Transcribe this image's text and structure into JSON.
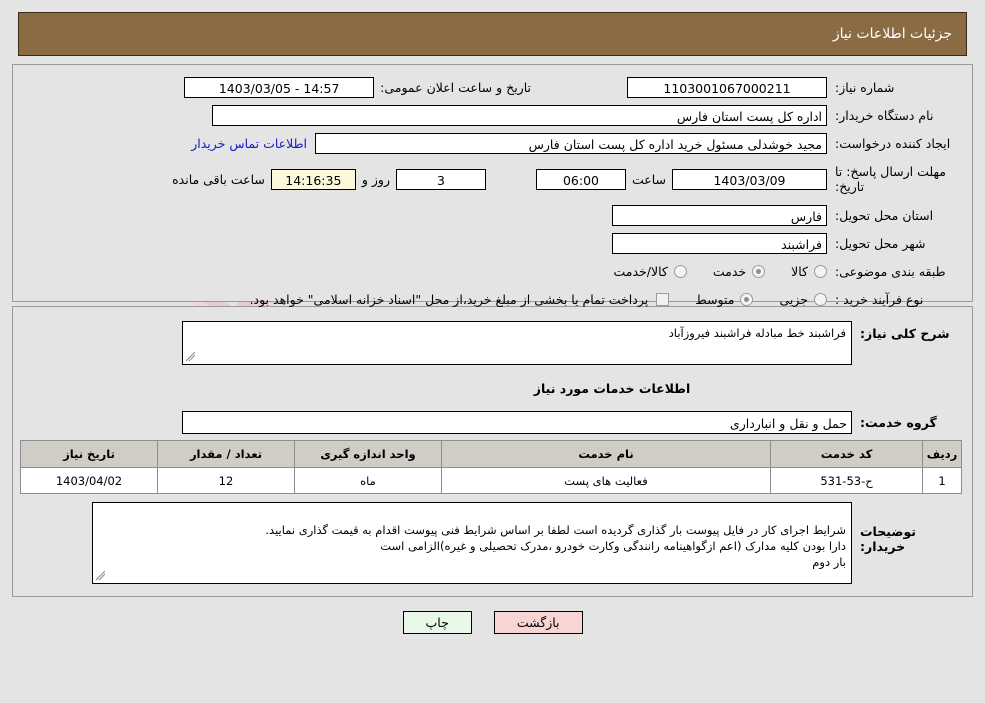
{
  "header": {
    "title": "جزئیات اطلاعات نیاز",
    "bar_color": "#8a6b43"
  },
  "watermark": {
    "text": "AnaTender.net"
  },
  "top_panel": {
    "need_number_label": "شماره نیاز:",
    "need_number_value": "1103001067000211",
    "public_announce_label": "تاریخ و ساعت اعلان عمومی:",
    "public_announce_value": "14:57 - 1403/03/05",
    "buyer_org_label": "نام دستگاه خریدار:",
    "buyer_org_value": "اداره کل پست استان فارس",
    "creator_label": "ایجاد کننده درخواست:",
    "creator_value": "مجید خوشدلی مسئول خرید اداره کل پست استان فارس",
    "contact_link": "اطلاعات تماس خریدار",
    "deadline_label": "مهلت ارسال پاسخ: تا تاریخ:",
    "deadline_date": "1403/03/09",
    "hour_label": "ساعت",
    "deadline_time": "06:00",
    "days_remaining": "3",
    "days_and_label": "روز و",
    "time_remaining": "14:16:35",
    "remaining_suffix_label": "ساعت باقی مانده",
    "province_label": "استان محل تحویل:",
    "province_value": "فارس",
    "city_label": "شهر محل تحویل:",
    "city_value": "فراشبند",
    "category_label": "طبقه بندی موضوعی:",
    "category_options": [
      {
        "label": "کالا",
        "selected": false
      },
      {
        "label": "خدمت",
        "selected": true
      },
      {
        "label": "کالا/خدمت",
        "selected": false
      }
    ],
    "process_label": "نوع فرآیند خرید :",
    "process_options": [
      {
        "label": "جزیی",
        "selected": false
      },
      {
        "label": "متوسط",
        "selected": true
      }
    ],
    "treasury_checkbox_checked": false,
    "treasury_note": "پرداخت تمام یا بخشی از مبلغ خرید،از محل \"اسناد خزانه اسلامی\" خواهد بود."
  },
  "mid_panel": {
    "general_desc_label": "شرح کلی نیاز:",
    "general_desc_value": "فراشبند خط مبادله فراشبند فیروزآباد",
    "services_section_title": "اطلاعات خدمات مورد نیاز",
    "service_group_label": "گروه خدمت:",
    "service_group_value": "حمل و نقل و انبارداری",
    "table": {
      "columns": [
        "ردیف",
        "کد خدمت",
        "نام خدمت",
        "واحد اندازه گیری",
        "تعداد / مقدار",
        "تاریخ نیاز"
      ],
      "rows": [
        {
          "row_no": "1",
          "service_code": "ح-53-531",
          "service_name": "فعالیت های پست",
          "unit": "ماه",
          "quantity": "12",
          "need_date": "1403/04/02"
        }
      ]
    },
    "buyer_notes_label": "توضیحات خریدار:",
    "buyer_notes_value": "شرایط اجرای کار در فایل پیوست بار گذاری گردیده است لطفا بر اساس شرایط فنی پیوست اقدام به قیمت گذاری نمایید.\nدارا بودن کلیه مدارک (اعم ازگواهینامه رانندگی وکارت خودرو ،مدرک تحصیلی و غیره)الزامی است\nبار دوم"
  },
  "footer": {
    "print_label": "چاپ",
    "back_label": "بازگشت"
  }
}
